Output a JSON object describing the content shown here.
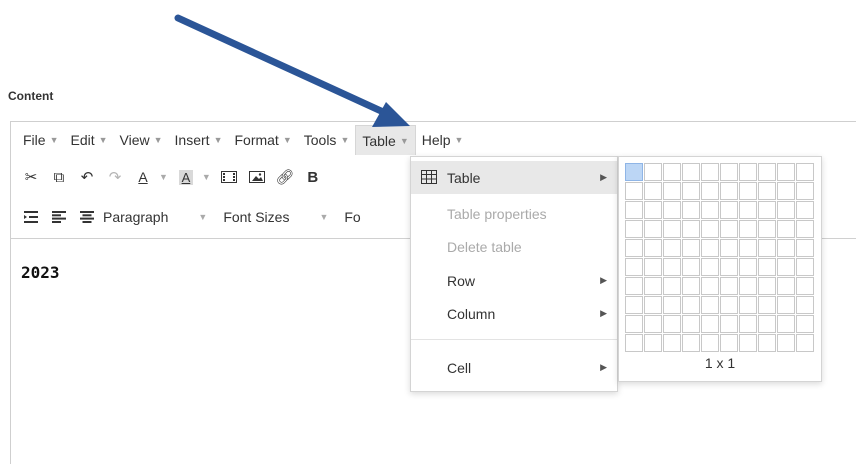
{
  "label": "Content",
  "menubar": [
    {
      "label": "File",
      "name": "menu-file"
    },
    {
      "label": "Edit",
      "name": "menu-edit"
    },
    {
      "label": "View",
      "name": "menu-view"
    },
    {
      "label": "Insert",
      "name": "menu-insert"
    },
    {
      "label": "Format",
      "name": "menu-format"
    },
    {
      "label": "Tools",
      "name": "menu-tools"
    },
    {
      "label": "Table",
      "name": "menu-table"
    },
    {
      "label": "Help",
      "name": "menu-help"
    }
  ],
  "toolbar": {
    "row1_icons": [
      "cut-icon",
      "copy-icon",
      "undo-icon",
      "redo-icon",
      "text-color-icon",
      "background-color-icon",
      "media-icon",
      "image-icon",
      "link-icon",
      "bold-icon"
    ],
    "text_color_label": "A",
    "bg_color_label": "A",
    "bold_label": "B",
    "row2_icons": [
      "indent-icon",
      "align-left-icon",
      "align-center-icon"
    ],
    "paragraph_label": "Paragraph",
    "font_sizes_label": "Font Sizes",
    "font_family_label": "Fo"
  },
  "document": {
    "text": "2023"
  },
  "table_menu": {
    "items": [
      {
        "label": "Table",
        "state": "highlighted",
        "has_submenu": true,
        "icon": "table-grid-icon"
      },
      {
        "label": "Table properties",
        "state": "disabled",
        "has_submenu": false
      },
      {
        "label": "Delete table",
        "state": "disabled",
        "has_submenu": false
      },
      {
        "label": "Row",
        "state": "enabled",
        "has_submenu": true
      },
      {
        "label": "Column",
        "state": "enabled",
        "has_submenu": true
      },
      {
        "label": "Cell",
        "state": "enabled",
        "has_submenu": true
      }
    ]
  },
  "table_grid": {
    "rows": 10,
    "cols": 10,
    "selected_rows": 1,
    "selected_cols": 1,
    "size_label": "1 x 1"
  },
  "colors": {
    "arrow": "#2b5597",
    "selection": "#bcd6f5",
    "highlight": "#e8e8e8"
  }
}
